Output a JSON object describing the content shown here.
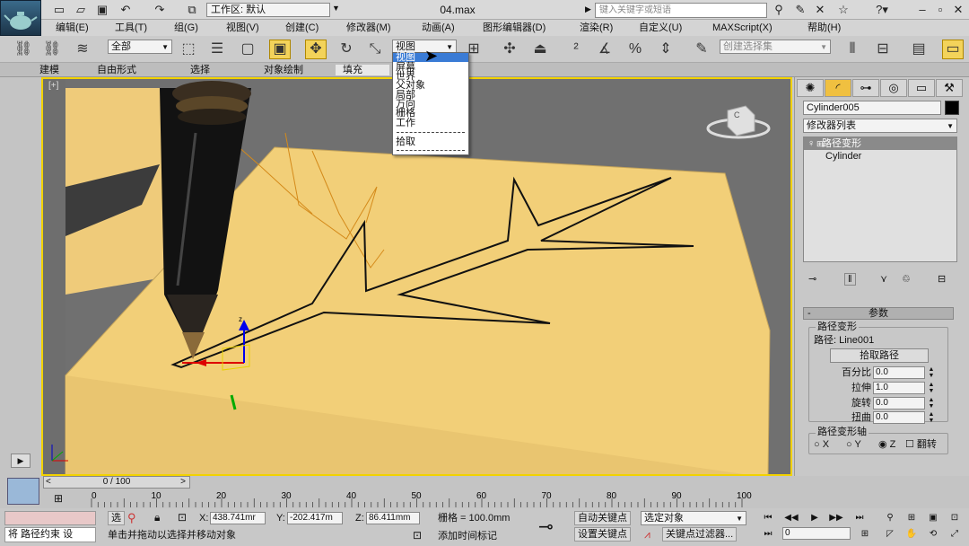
{
  "titlebar": {
    "workspace_label": "工作区: 默认",
    "file_title": "04.max",
    "search_placeholder": "键入关键字或短语",
    "help_label": "?"
  },
  "menubar": {
    "items": [
      "编辑(E)",
      "工具(T)",
      "组(G)",
      "视图(V)",
      "创建(C)",
      "修改器(M)",
      "动画(A)",
      "图形编辑器(D)",
      "渲染(R)",
      "自定义(U)",
      "MAXScript(X)",
      "帮助(H)"
    ]
  },
  "toolbar": {
    "filter_label": "全部",
    "refcoord_label": "视图",
    "selection_set_placeholder": "创建选择集"
  },
  "ribbon": {
    "tabs": [
      "建模",
      "自由形式",
      "选择",
      "对象绘制",
      "填充"
    ]
  },
  "dropdown": {
    "items": [
      "视图",
      "屏幕",
      "世界",
      "父对象",
      "局部",
      "万向",
      "栅格",
      "工作",
      "拾取"
    ],
    "highlighted": "视图"
  },
  "viewport": {
    "label": "[+]",
    "viewcube_letter": "C"
  },
  "command_panel": {
    "object_name": "Cylinder005",
    "modifier_list": "修改器列表",
    "stack": [
      "路径变形",
      "Cylinder"
    ],
    "rollout_title": "参数",
    "group_title": "路径变形",
    "path_label": "路径: Line001",
    "pick_path_button": "拾取路径",
    "params": [
      {
        "label": "百分比",
        "value": "0.0"
      },
      {
        "label": "拉伸",
        "value": "1.0"
      },
      {
        "label": "旋转",
        "value": "0.0"
      },
      {
        "label": "扭曲",
        "value": "0.0"
      }
    ],
    "axis_group_title": "路径变形轴",
    "axis_options": [
      "X",
      "Y",
      "Z"
    ],
    "selected_axis": "Z",
    "flip_label": "翻转"
  },
  "timeline": {
    "frame_display": "0 / 100",
    "ticks": [
      "0",
      "10",
      "20",
      "30",
      "40",
      "50",
      "60",
      "70",
      "80",
      "90",
      "100"
    ]
  },
  "statusbar": {
    "selected_label": "选",
    "coord_x_label": "X:",
    "coord_x": "438.741mr",
    "coord_y_label": "Y:",
    "coord_y": "-202.417m",
    "coord_z_label": "Z:",
    "coord_z": "86.411mm",
    "grid_label": "栅格 = 100.0mm",
    "auto_key": "自动关键点",
    "set_key": "设置关键点",
    "key_mode_label": "选定对象",
    "key_filter": "关键点过滤器...",
    "add_time_tag": "添加时间标记",
    "prompt": "单击并拖动以选择并移动对象",
    "left_status": "将 路径约束 设",
    "frame_field": "0"
  }
}
